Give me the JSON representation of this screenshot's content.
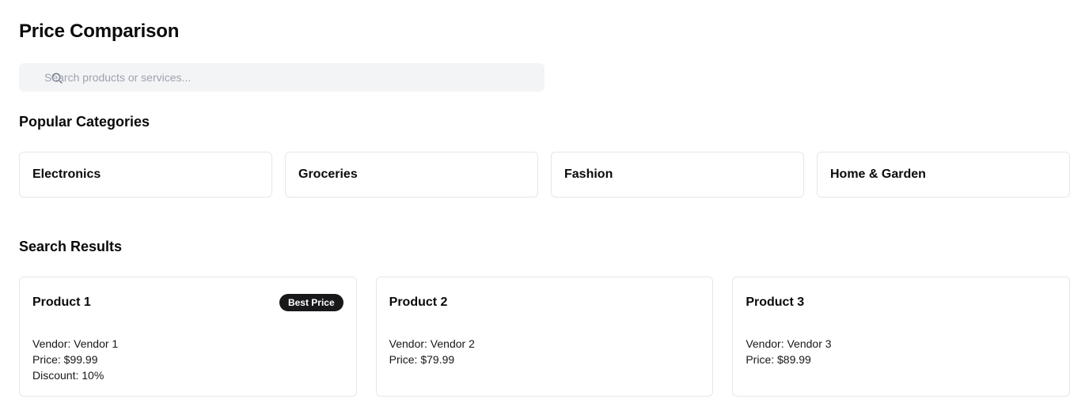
{
  "page_title": "Price Comparison",
  "search": {
    "placeholder": "Search products or services...",
    "value": ""
  },
  "categories_section": {
    "heading": "Popular Categories",
    "items": [
      {
        "label": "Electronics"
      },
      {
        "label": "Groceries"
      },
      {
        "label": "Fashion"
      },
      {
        "label": "Home & Garden"
      }
    ]
  },
  "results_section": {
    "heading": "Search Results",
    "items": [
      {
        "name": "Product 1",
        "badge": "Best Price",
        "vendor": "Vendor: Vendor 1",
        "price": "Price: $99.99",
        "discount": "Discount: 10%"
      },
      {
        "name": "Product 2",
        "vendor": "Vendor: Vendor 2",
        "price": "Price: $79.99"
      },
      {
        "name": "Product 3",
        "vendor": "Vendor: Vendor 3",
        "price": "Price: $89.99"
      }
    ]
  },
  "colors": {
    "badge_bg": "#18181b",
    "search_bg": "#f3f4f6",
    "card_border": "#e5e7eb"
  }
}
